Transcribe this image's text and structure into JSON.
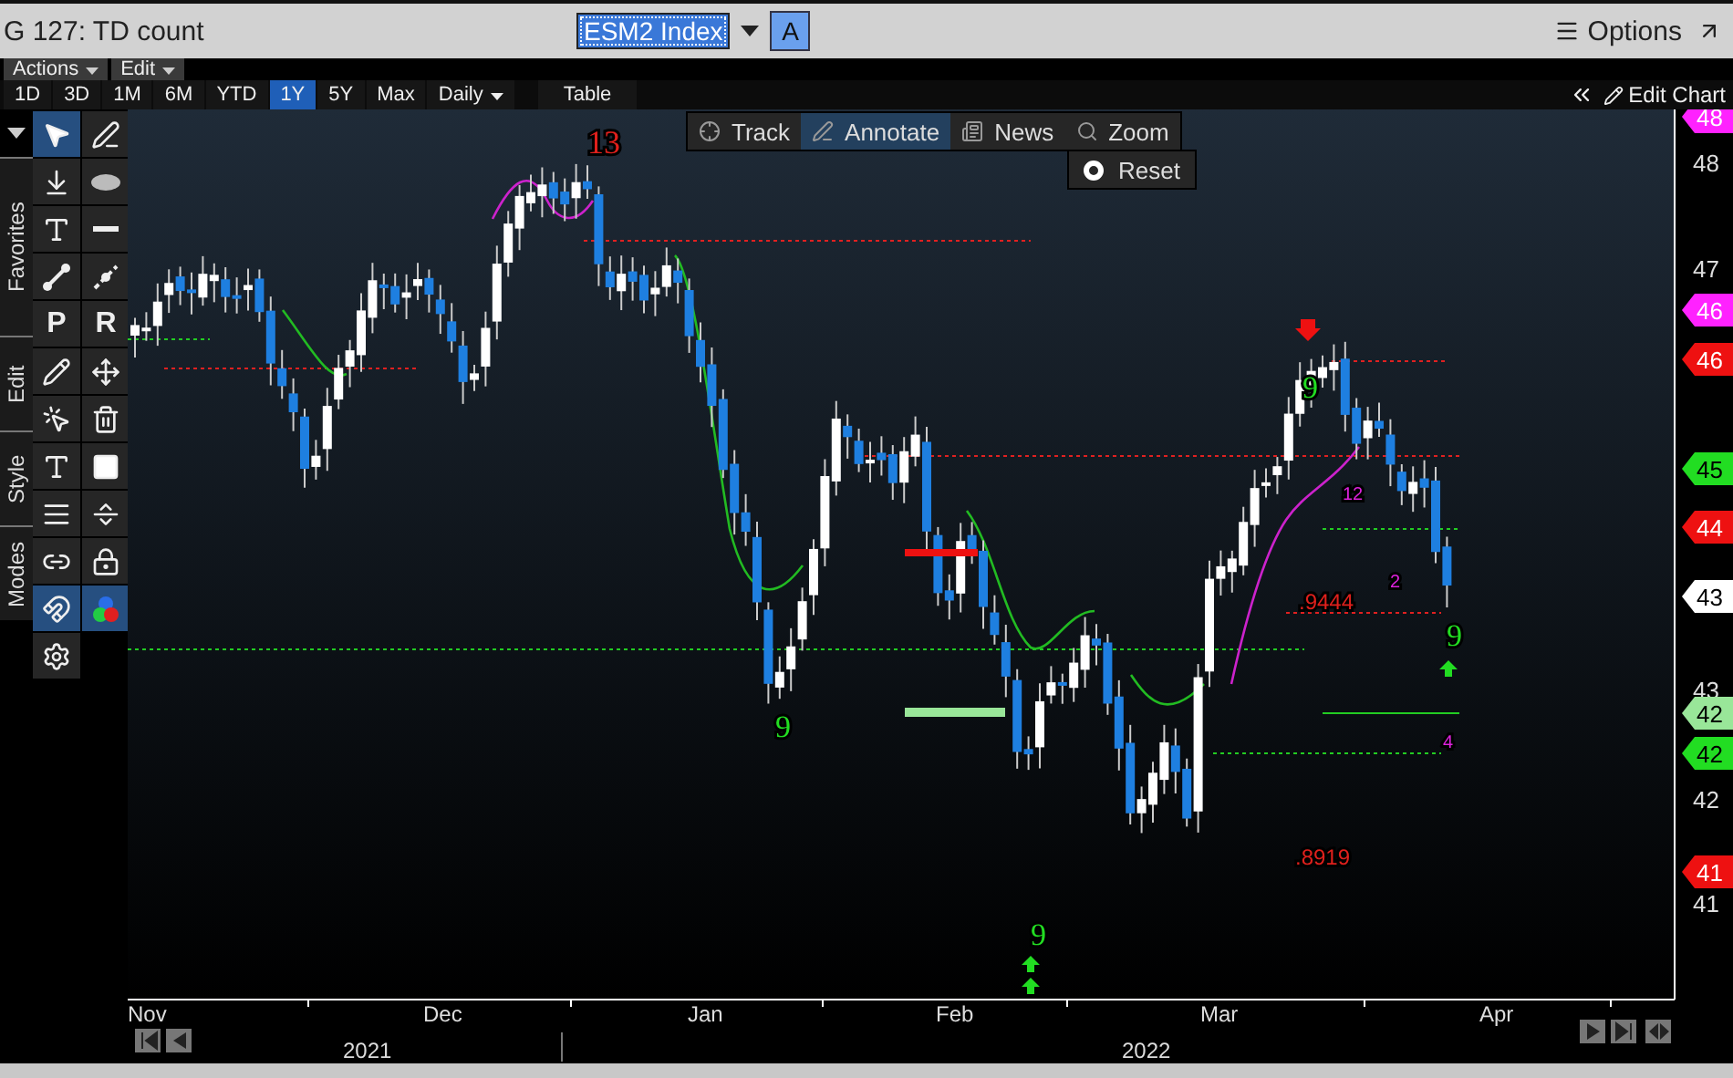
{
  "header": {
    "title": "G 127: TD count",
    "security": "ESM2 Index",
    "source_button": "A",
    "options": "Options"
  },
  "menus": [
    {
      "label": "Actions"
    },
    {
      "label": "Edit"
    }
  ],
  "ranges": [
    {
      "label": "1D",
      "selected": false
    },
    {
      "label": "3D",
      "selected": false
    },
    {
      "label": "1M",
      "selected": false
    },
    {
      "label": "6M",
      "selected": false
    },
    {
      "label": "YTD",
      "selected": false
    },
    {
      "label": "1Y",
      "selected": true
    },
    {
      "label": "5Y",
      "selected": false
    },
    {
      "label": "Max",
      "selected": false
    }
  ],
  "frequency": "Daily",
  "table_button": "Table",
  "edit_chart": "Edit Chart",
  "side_tabs": [
    {
      "label": "Favorites"
    },
    {
      "label": "Edit"
    },
    {
      "label": "Style"
    },
    {
      "label": "Modes"
    }
  ],
  "palette_letters": [
    "P",
    "R"
  ],
  "chart_toolbar": [
    {
      "label": "Track",
      "selected": false
    },
    {
      "label": "Annotate",
      "selected": true
    },
    {
      "label": "News",
      "selected": false
    },
    {
      "label": "Zoom",
      "selected": false
    }
  ],
  "reset": "Reset",
  "annotations": [
    {
      "text": "13",
      "color": "#e0201c",
      "kind": "large"
    },
    {
      "text": "9",
      "color": "#22dd22",
      "kind": "large"
    },
    {
      "text": "9",
      "color": "#22dd22",
      "kind": "large"
    },
    {
      "text": "9",
      "color": "#22dd22",
      "kind": "large"
    },
    {
      "text": "9",
      "color": "#22dd22",
      "kind": "large"
    },
    {
      "text": ".9444",
      "color": "#e0201c",
      "kind": "small"
    },
    {
      "text": ".8919",
      "color": "#e0201c",
      "kind": "small"
    },
    {
      "text": "12",
      "color": "#dd22dd",
      "kind": "small"
    },
    {
      "text": "2",
      "color": "#dd22dd",
      "kind": "small"
    },
    {
      "text": "4",
      "color": "#dd22dd",
      "kind": "small"
    }
  ],
  "y_axis": {
    "ticks": [
      "48",
      "47",
      "43",
      "42",
      "41"
    ],
    "tags": [
      {
        "text": "48",
        "color": "#ff22ff"
      },
      {
        "text": "46",
        "color": "#ff22ff"
      },
      {
        "text": "46",
        "color": "#ee1111"
      },
      {
        "text": "45",
        "color": "#22dd22"
      },
      {
        "text": "44",
        "color": "#ee1111"
      },
      {
        "text": "43",
        "color": "#ffffff"
      },
      {
        "text": "42",
        "color": "#99e699"
      },
      {
        "text": "42",
        "color": "#22dd22"
      },
      {
        "text": "41",
        "color": "#ee1111"
      }
    ]
  },
  "x_axis": {
    "months": [
      "Nov",
      "Dec",
      "Jan",
      "Feb",
      "Mar",
      "Apr"
    ],
    "years": [
      "2021",
      "2022"
    ]
  }
}
